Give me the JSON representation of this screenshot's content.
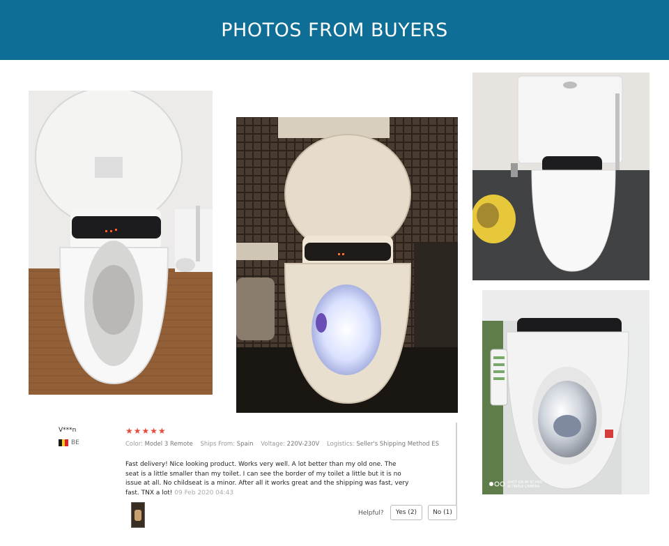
{
  "header": {
    "title": "PHOTOS FROM BUYERS"
  },
  "colors": {
    "header_bg": "#0f6e96",
    "stars": "#e84a3b"
  },
  "photos": [
    {
      "description": ""
    },
    {
      "description": ""
    },
    {
      "description": ""
    },
    {
      "description": ""
    }
  ],
  "photo4_overlay": {
    "line1": "SHOT ON MI 9T PRO",
    "line2": "AI TRIPLE CAMERA"
  },
  "review": {
    "name": "V***n",
    "country": "BE",
    "stars": "★★★★★",
    "rating": 5,
    "color_label": "Color:",
    "color_value": "Model 3 Remote",
    "ships_label": "Ships From:",
    "ships_value": "Spain",
    "voltage_label": "Voltage:",
    "voltage_value": "220V-230V",
    "logistics_label": "Logistics:",
    "logistics_value": "Seller's Shipping Method ES",
    "text": "Fast delivery! Nice looking product. Works very well. A lot better than my old one. The seat is a little smaller than my toilet. I can see the border of my toilet a little but it is no issue at all. No childseat is a minor. After all it works great and the shipping was fast, very fast. TNX a lot!",
    "date": "09 Feb 2020 04:43",
    "helpful_label": "Helpful?",
    "yes_label": "Yes (2)",
    "no_label": "No (1)"
  }
}
